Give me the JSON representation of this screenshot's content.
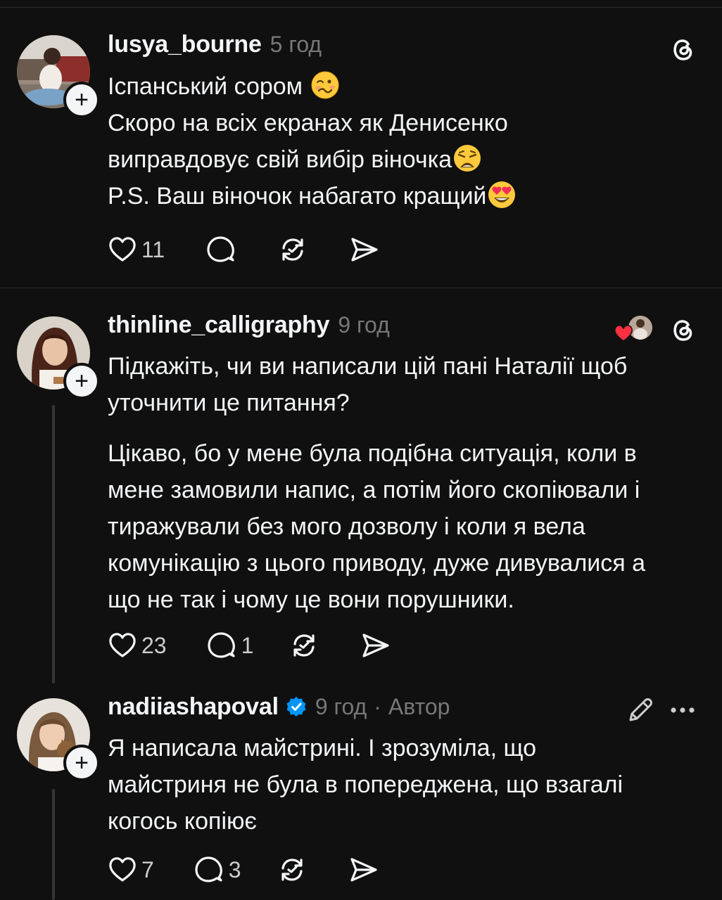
{
  "posts": [
    {
      "username": "lusya_bourne",
      "time": "5 год",
      "lines": [
        "Іспанський сором ",
        "Скоро на всіх екранах як Денисенко",
        "виправдовує свій вибір віночка",
        "P.S. Ваш віночок набагато кращий"
      ],
      "line_emojis": [
        "woozy-face-emoji",
        "",
        "weary-face-emoji",
        "heart-eyes-emoji"
      ],
      "likes": "11",
      "replies": "",
      "top_right_icon": "threads-logo-icon"
    },
    {
      "username": "thinline_calligraphy",
      "time": "9 год",
      "paragraph1": [
        "Підкажіть, чи ви написали цій пані Наталії щоб",
        "уточнити це питання?"
      ],
      "paragraph2": [
        "Цікаво, бо у мене була подібна ситуація, коли в",
        "мене замовили напис, а потім його скопіювали і",
        "тиражували без мого дозволу і коли я вела",
        "комунікацію з цього приводу, дуже дивувалися а",
        "що не так і чому це вони порушники."
      ],
      "likes": "23",
      "replies": "1",
      "top_right_icon": "threads-logo-icon",
      "liked_by_author": true
    },
    {
      "username": "nadiiashapoval",
      "verified": true,
      "time": "9 год",
      "separator": "·",
      "author_label": "Автор",
      "lines": [
        "Я написала майстрині. І зрозуміла, що",
        "майстриня не була в попереджена, що взагалі",
        "когось копіює"
      ],
      "likes": "7",
      "replies": "3",
      "top_right_icons": [
        "edit-pencil-icon",
        "more-options-icon"
      ]
    }
  ],
  "colors": {
    "background": "#101010",
    "text": "#f3f5f7",
    "secondary": "#777777",
    "divider": "#2a2a2a",
    "verified": "#0095f6",
    "like_heart": "#ff3040"
  }
}
